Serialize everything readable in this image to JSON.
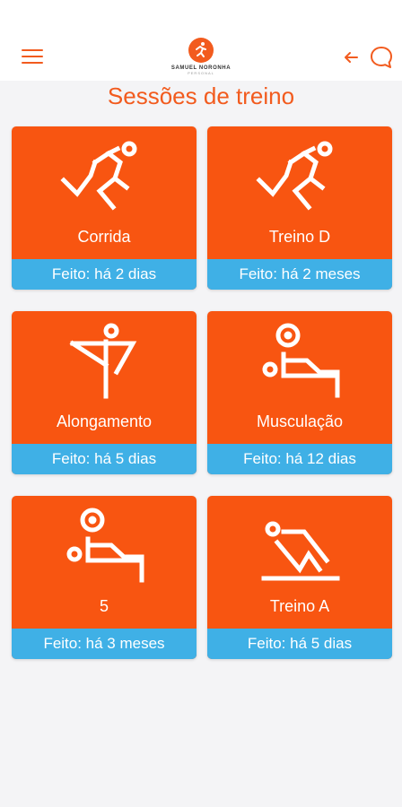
{
  "header": {
    "logo_text": "SAMUEL NORONHA",
    "logo_sub": "PERSONAL",
    "menu_icon": "hamburger-icon",
    "back_icon": "arrow-left-icon",
    "chat_icon": "chat-bubble-icon",
    "accent": "#f25b1e"
  },
  "title": "Sessões de treino",
  "colors": {
    "card": "#f85511",
    "status": "#3fb0e6",
    "text": "#ffffff"
  },
  "sessions": [
    {
      "name": "Corrida",
      "status": "Feito: há 2 dias",
      "icon": "runner-icon"
    },
    {
      "name": "Treino D",
      "status": "Feito: há 2 meses",
      "icon": "runner-icon"
    },
    {
      "name": "Alongamento",
      "status": "Feito: há 5 dias",
      "icon": "stretching-icon"
    },
    {
      "name": "Musculação",
      "status": "Feito: há 12 dias",
      "icon": "weightlifting-icon"
    },
    {
      "name": "5",
      "status": "Feito: há 3 meses",
      "icon": "weightlifting-icon"
    },
    {
      "name": "Treino A",
      "status": "Feito: há 5 dias",
      "icon": "situp-icon"
    }
  ]
}
